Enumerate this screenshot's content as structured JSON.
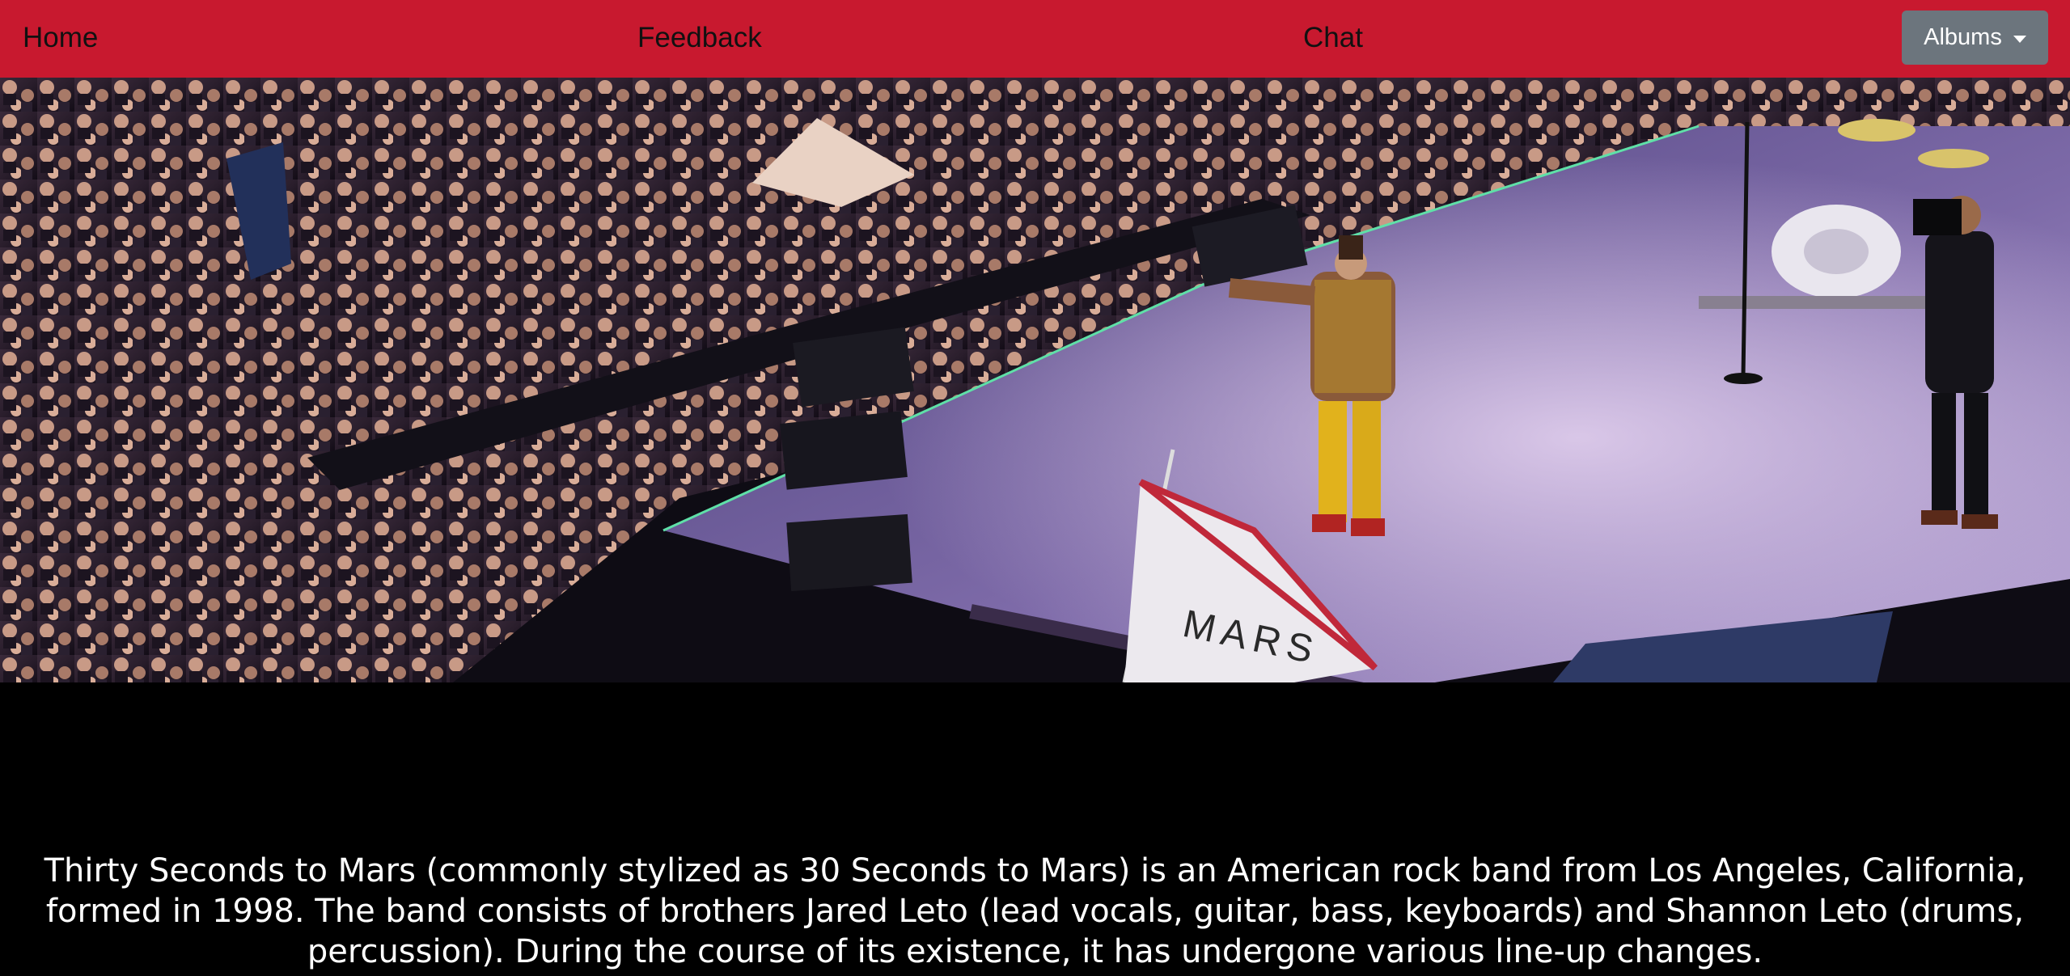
{
  "navbar": {
    "home_label": "Home",
    "feedback_label": "Feedback",
    "chat_label": "Chat",
    "albums_dropdown_label": "Albums",
    "background_color": "#c8192f",
    "dropdown_color": "#6c757d"
  },
  "hero": {
    "image_subject": "concert-stage-photo",
    "flag_text": "MARS"
  },
  "content": {
    "description": "Thirty Seconds to Mars (commonly stylized as 30 Seconds to Mars) is an American rock band from Los Angeles, California, formed in 1998. The band consists of brothers Jared Leto (lead vocals, guitar, bass, keyboards) and Shannon Leto (drums, percussion). During the course of its existence, it has undergone various line-up changes."
  }
}
